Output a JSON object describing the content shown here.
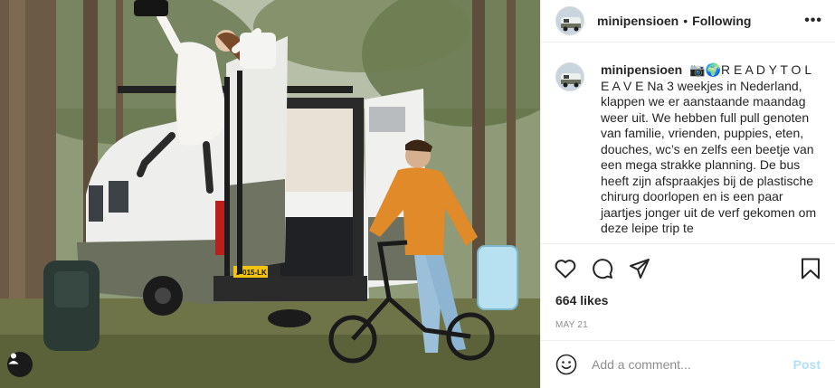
{
  "post": {
    "image_alt": "",
    "user_tag_icon": "user-icon"
  },
  "header": {
    "username": "minipensioen",
    "separator": "•",
    "follow_status": "Following",
    "more_icon": "more-options-icon",
    "more_label": "•••"
  },
  "caption": {
    "username": "minipensioen",
    "text": "📷🌍R E A D Y T O L E A V E Na 3 weekjes in Nederland, klappen we er aanstaande maandag weer uit. We hebben full pull genoten van familie, vrienden, puppies, eten, douches, wc’s en zelfs een beetje van een mega strakke planning. De bus heeft zijn afspraakjes bij de plastische chirurg doorlopen en is een paar jaartjes jonger uit de verf gekomen om deze leipe trip te"
  },
  "actions": {
    "like_icon": "heart-icon",
    "comment_icon": "comment-icon",
    "share_icon": "share-icon",
    "save_icon": "bookmark-icon"
  },
  "likes": "664 likes",
  "date": "MAY 21",
  "comment_box": {
    "emoji_icon": "emoji-icon",
    "placeholder": "Add a comment...",
    "post_label": "Post"
  },
  "colors": {
    "text": "#262626",
    "muted": "#8e8e8e",
    "post_disabled": "#b2dffc",
    "border": "#efefef"
  }
}
